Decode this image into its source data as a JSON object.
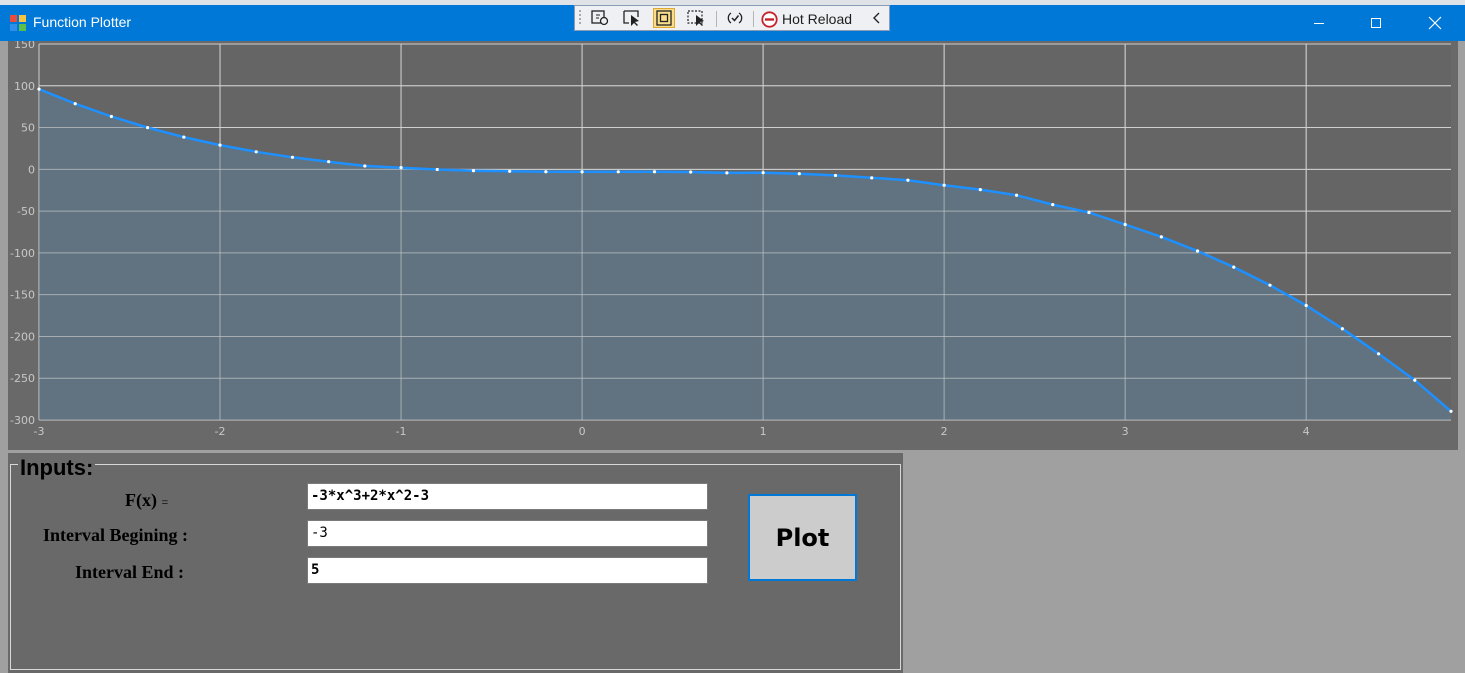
{
  "window": {
    "title": "Function Plotter"
  },
  "debug_toolbar": {
    "hot_reload_label": "Hot Reload",
    "tools": [
      "select-element-icon",
      "select-pointer-icon",
      "track-focus-icon",
      "display-layout-icon",
      "hot-reload-refresh-icon",
      "stop-icon",
      "collapse-chevron-icon"
    ]
  },
  "colors": {
    "titlebar": "#0078d7",
    "chart_background": "#696969",
    "plot_area": "#607585",
    "series_line": "#1e90ff",
    "gridline": "#d0d0d0",
    "tick_text": "#c8c8c8"
  },
  "chart_data": {
    "type": "area",
    "title": "",
    "xlabel": "",
    "ylabel": "",
    "xlim": [
      -3,
      4.8
    ],
    "ylim": [
      -300,
      150
    ],
    "x_ticks": [
      "-3",
      "-2",
      "-1",
      "0",
      "1",
      "2",
      "3",
      "4"
    ],
    "y_ticks": [
      "150",
      "100",
      "50",
      "0",
      "-50",
      "-100",
      "-150",
      "-200",
      "-250",
      "-300"
    ],
    "grid": true,
    "legend": "none",
    "series": [
      {
        "x": [
          -3,
          -2.8,
          -2.6,
          -2.4,
          -2.2,
          -2,
          -1.8,
          -1.6,
          -1.4,
          -1.2,
          -1,
          -0.8,
          -0.6,
          -0.4,
          -0.2,
          0,
          0.2,
          0.4,
          0.6,
          0.8,
          1,
          1.2,
          1.4,
          1.6,
          1.8,
          2,
          2.2,
          2.4,
          2.6,
          2.8,
          3,
          3.2,
          3.4,
          3.6,
          3.8,
          4,
          4.2,
          4.4,
          4.6,
          4.8
        ],
        "y": [
          96,
          78.54,
          63.24,
          49.99,
          38.62,
          29,
          20.98,
          14.41,
          9.16,
          4.06,
          2,
          -0.18,
          -1.63,
          -2.36,
          -2.9,
          -3,
          -2.94,
          -2.87,
          -3.23,
          -4.26,
          -4,
          -5.3,
          -7.31,
          -10.17,
          -13.02,
          -19,
          -24.27,
          -31.0,
          -42.2,
          -51.64,
          -66,
          -80.82,
          -97.78,
          -117.0,
          -138.64,
          -163,
          -190.79,
          -220.77,
          -252.4,
          -289.58
        ]
      }
    ]
  },
  "inputs": {
    "group_title": "Inputs:",
    "fx_label": "F(x)",
    "fx_suffix": "=",
    "fx_value": "-3*x^3+2*x^2-3",
    "begin_label": "Interval Begining :",
    "begin_value": "-3",
    "end_label": "Interval End :",
    "end_value": "5",
    "plot_button": "Plot"
  }
}
